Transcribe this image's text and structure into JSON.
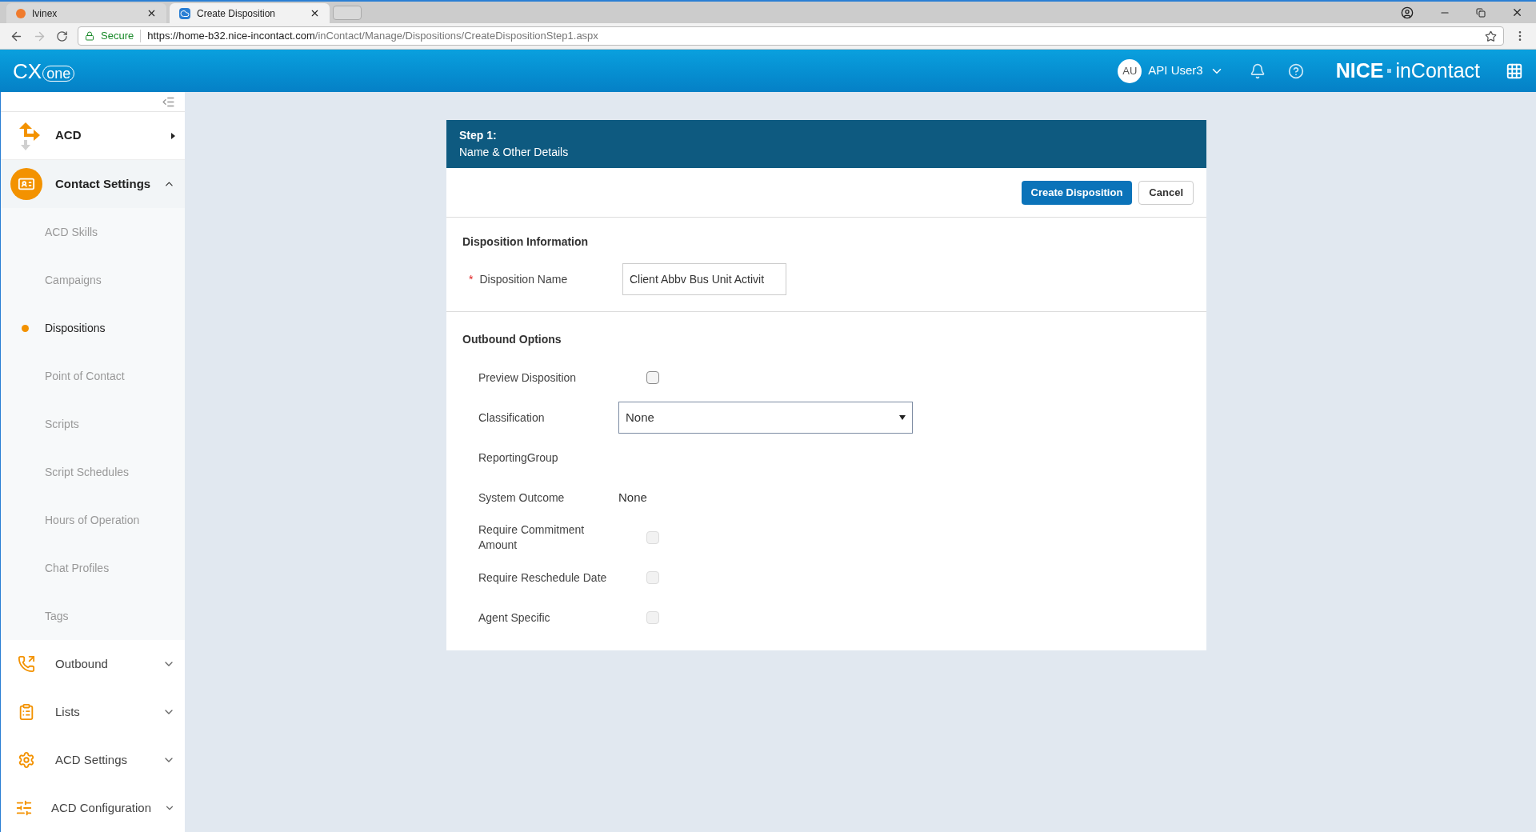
{
  "browser": {
    "tabs": [
      {
        "title": "Ivinex",
        "selected": false
      },
      {
        "title": "Create Disposition",
        "selected": true
      }
    ],
    "secure_label": "Secure",
    "url_host": "https://home-b32.nice-incontact.com",
    "url_path": "/inContact/Manage/Dispositions/CreateDispositionStep1.aspx"
  },
  "header": {
    "logo_cx": "CX",
    "logo_one": "one",
    "user_initials": "AU",
    "user_name": "API User3",
    "brand_nice": "NICE",
    "brand_incontact": "inContact"
  },
  "sidebar": {
    "items": [
      {
        "label": "ACD",
        "kind": "flyout",
        "selected": false
      },
      {
        "label": "Contact Settings",
        "kind": "accordion",
        "expanded": true,
        "selected": true,
        "children": [
          {
            "label": "ACD Skills",
            "selected": false
          },
          {
            "label": "Campaigns",
            "selected": false
          },
          {
            "label": "Dispositions",
            "selected": true
          },
          {
            "label": "Point of Contact",
            "selected": false
          },
          {
            "label": "Scripts",
            "selected": false
          },
          {
            "label": "Script Schedules",
            "selected": false
          },
          {
            "label": "Hours of Operation",
            "selected": false
          },
          {
            "label": "Chat Profiles",
            "selected": false
          },
          {
            "label": "Tags",
            "selected": false
          }
        ]
      },
      {
        "label": "Outbound",
        "kind": "accordion",
        "expanded": false,
        "selected": false
      },
      {
        "label": "Lists",
        "kind": "accordion",
        "expanded": false,
        "selected": false
      },
      {
        "label": "ACD Settings",
        "kind": "accordion",
        "expanded": false,
        "selected": false
      },
      {
        "label": "ACD Configuration",
        "kind": "accordion",
        "expanded": false,
        "selected": false
      }
    ]
  },
  "form": {
    "step": "Step 1:",
    "step_title": "Name & Other Details",
    "buttons": [
      {
        "label": "Create Disposition",
        "kind": "primary"
      },
      {
        "label": "Cancel",
        "kind": "secondary"
      }
    ],
    "info_section": {
      "title": "Disposition Information",
      "name_label": "Disposition Name",
      "required_mark": "*",
      "name_value": "Client Abbv Bus Unit Activit"
    },
    "outbound_section": {
      "title": "Outbound Options",
      "rows": [
        {
          "label": "Preview Disposition",
          "kind": "checkbox",
          "checked": false,
          "disabled": false
        },
        {
          "label": "Classification",
          "kind": "select",
          "value": "None"
        },
        {
          "label": "ReportingGroup",
          "kind": "empty"
        },
        {
          "label": "System Outcome",
          "kind": "text",
          "value": "None"
        },
        {
          "label": "Require Commitment Amount",
          "kind": "checkbox",
          "checked": false,
          "disabled": true
        },
        {
          "label": "Require Reschedule Date",
          "kind": "checkbox",
          "checked": false,
          "disabled": true
        },
        {
          "label": "Agent Specific",
          "kind": "checkbox",
          "checked": false,
          "disabled": true
        }
      ]
    }
  }
}
